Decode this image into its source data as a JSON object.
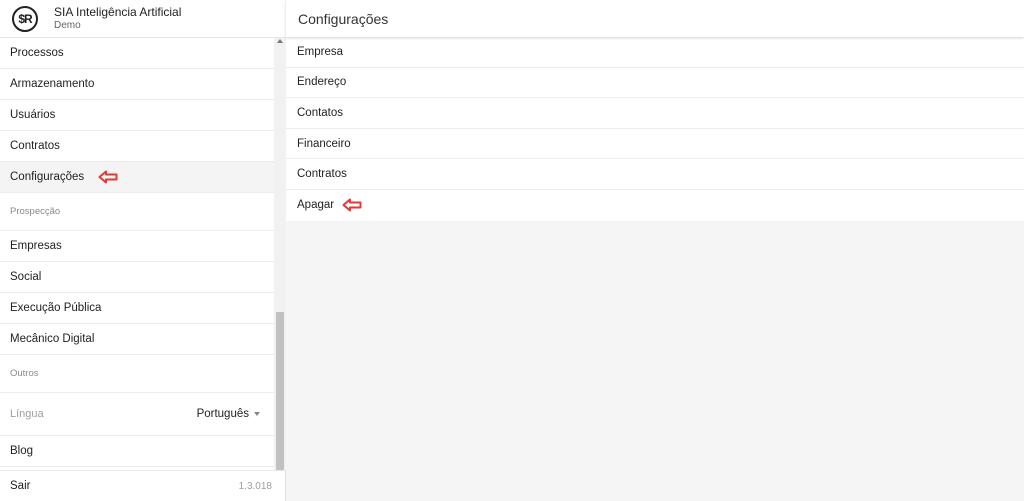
{
  "brand": {
    "logo_text": "$R",
    "title": "SIA Inteligência Artificial",
    "subtitle": "Demo"
  },
  "sidebar": {
    "group1": [
      "Processos",
      "Armazenamento",
      "Usuários",
      "Contratos",
      "Configurações"
    ],
    "section_prospeccao": "Prospecção",
    "group2": [
      "Empresas",
      "Social",
      "Execução Pública",
      "Mecânico Digital"
    ],
    "section_outros": "Outros",
    "language": {
      "label": "Língua",
      "value": "Português"
    },
    "blog": "Blog",
    "logout": "Sair",
    "version": "1.3.018"
  },
  "main": {
    "title": "Configurações",
    "items": [
      "Empresa",
      "Endereço",
      "Contatos",
      "Financeiro",
      "Contratos",
      "Apagar"
    ]
  },
  "annotation_color": "#e53935"
}
